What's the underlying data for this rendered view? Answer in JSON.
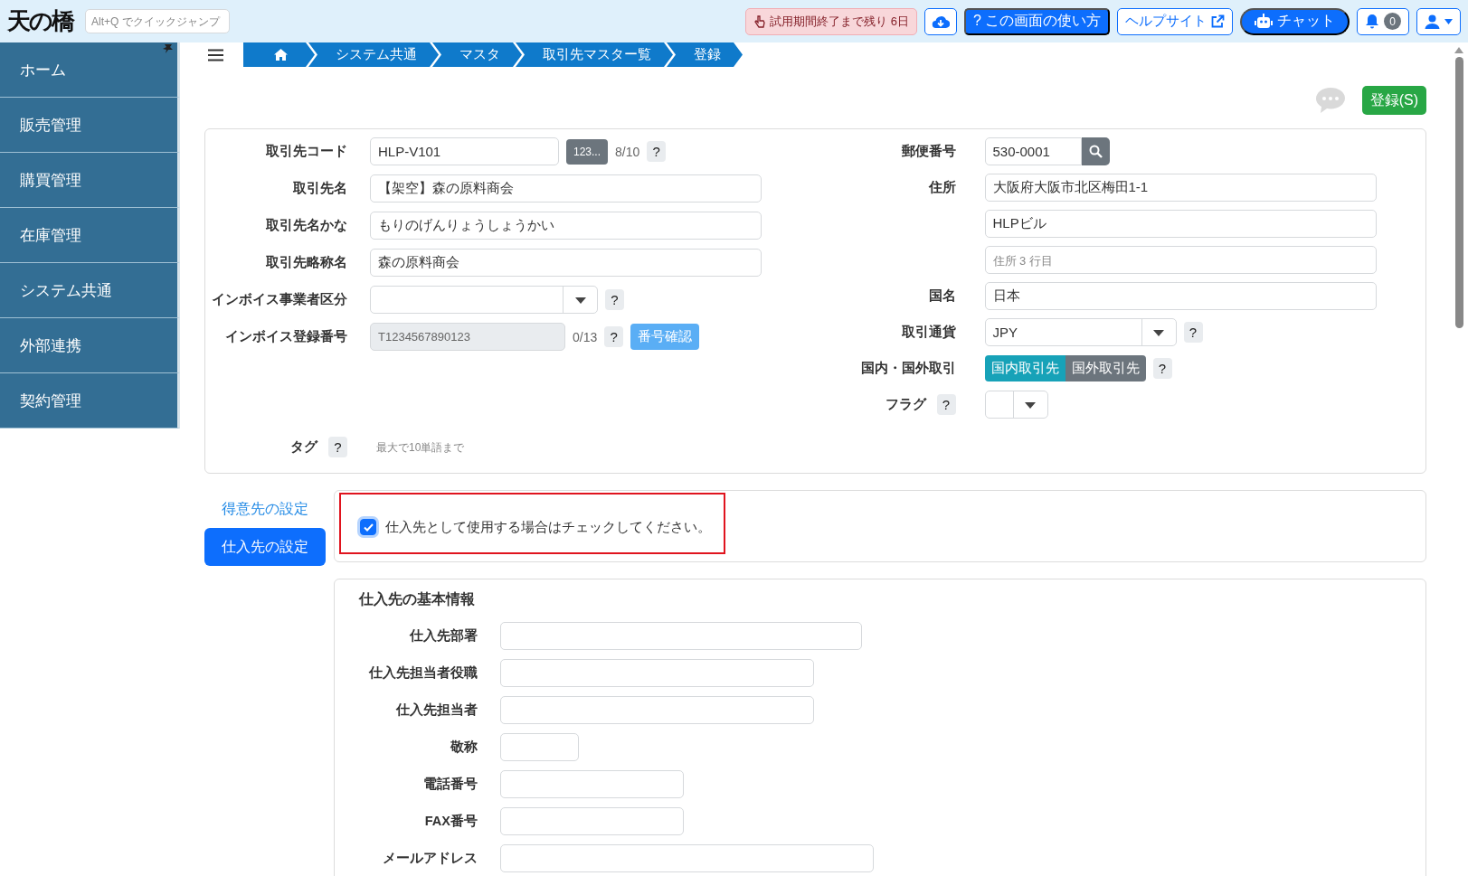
{
  "header": {
    "logo": "天の橋",
    "quick_jump": {
      "placeholder": "Alt+Q でクイックジャンプ"
    },
    "trial_notice": "試用期間終了まで残り 6日",
    "how_to_button": "? この画面の使い方",
    "help_link": "ヘルプサイト",
    "chat_button": "チャット",
    "notification_count": "0"
  },
  "sidebar": {
    "items": [
      {
        "label": "ホーム",
        "selected": false
      },
      {
        "label": "販売管理",
        "selected": false
      },
      {
        "label": "購買管理",
        "selected": false
      },
      {
        "label": "在庫管理",
        "selected": false
      },
      {
        "label": "システム共通",
        "selected": false
      },
      {
        "label": "外部連携",
        "selected": false
      },
      {
        "label": "契約管理",
        "selected": false
      }
    ]
  },
  "breadcrumb": [
    {
      "kind": "home"
    },
    {
      "kind": "page",
      "label": "システム共通"
    },
    {
      "kind": "page",
      "label": "マスタ"
    },
    {
      "kind": "page",
      "label": "取引先マスター覧"
    },
    {
      "kind": "page",
      "label": "登録"
    }
  ],
  "save_button": "登録(S)",
  "partner_form": {
    "left": [
      {
        "kind": "code",
        "label": "取引先コード",
        "value": "HLP-V101",
        "addon": "123...",
        "counter": "8/10",
        "help": "?"
      },
      {
        "kind": "text",
        "label": "取引先名",
        "value": "【架空】森の原料商会"
      },
      {
        "kind": "text",
        "label": "取引先名かな",
        "value": "もりのげんりょうしょうかい"
      },
      {
        "kind": "text",
        "label": "取引先略称名",
        "value": "森の原料商会"
      },
      {
        "kind": "select",
        "label": "インボイス事業者区分",
        "help": "?"
      },
      {
        "kind": "invoice",
        "label": "インボイス登録番号",
        "value": "T1234567890123",
        "disabled": true,
        "counter": "0/13",
        "help": "?",
        "action": "番号確認"
      }
    ],
    "right": [
      {
        "kind": "postal",
        "label": "郵便番号",
        "value": "530-0001"
      },
      {
        "kind": "text",
        "label": "住所",
        "value": "大阪府大阪市北区梅田1-1"
      },
      {
        "kind": "text",
        "value": "HLPビル"
      },
      {
        "kind": "text",
        "placeholder": "住所 3 行目"
      },
      {
        "kind": "text",
        "label": "国名",
        "value": "日本"
      },
      {
        "kind": "select",
        "label": "取引通貨",
        "value": "JPY",
        "help": "?"
      },
      {
        "kind": "toggle",
        "label": "国内・国外取引",
        "help": "?",
        "options": [
          {
            "label": "国内取引先",
            "selected": true
          },
          {
            "label": "国外取引先",
            "selected": false
          }
        ]
      },
      {
        "kind": "mini-select",
        "label": "フラグ",
        "label_help": "?"
      }
    ],
    "tags": {
      "label": "タグ",
      "help": "?",
      "placeholder": "最大で10単語まで"
    }
  },
  "side_tabs": [
    {
      "label": "得意先の設定",
      "selected": false
    },
    {
      "label": "仕入先の設定",
      "selected": true
    }
  ],
  "supplier_checkbox": {
    "label": "仕入先として使用する場合はチェックしてください。",
    "checked": true
  },
  "supplier_basic": {
    "title": "仕入先の基本情報",
    "fields": [
      {
        "kind": "department",
        "label": "仕入先部署"
      },
      {
        "kind": "title",
        "label": "仕入先担当者役職"
      },
      {
        "kind": "person",
        "label": "仕入先担当者"
      },
      {
        "kind": "honorific",
        "label": "敬称"
      },
      {
        "kind": "phone",
        "label": "電話番号"
      },
      {
        "kind": "fax",
        "label": "FAX番号"
      },
      {
        "kind": "email",
        "label": "メールアドレス"
      }
    ]
  }
}
